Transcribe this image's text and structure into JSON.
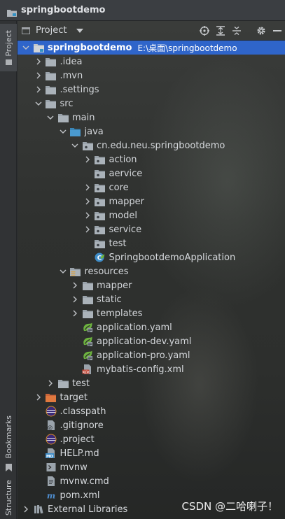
{
  "window": {
    "title": "springbootdemo"
  },
  "stripe": {
    "project": "Project",
    "bookmarks": "Bookmarks",
    "structure": "Structure"
  },
  "toolbar": {
    "view": "Project"
  },
  "tree": [
    {
      "label": "springbootdemo",
      "path": "E:\\桌面\\springbootdemo",
      "indent": 0,
      "arrow": "down",
      "icon": "module",
      "selected": true,
      "bold": true
    },
    {
      "label": ".idea",
      "indent": 1,
      "arrow": "right",
      "icon": "folder"
    },
    {
      "label": ".mvn",
      "indent": 1,
      "arrow": "right",
      "icon": "folder"
    },
    {
      "label": ".settings",
      "indent": 1,
      "arrow": "right",
      "icon": "folder"
    },
    {
      "label": "src",
      "indent": 1,
      "arrow": "down",
      "icon": "folder"
    },
    {
      "label": "main",
      "indent": 2,
      "arrow": "down",
      "icon": "folder"
    },
    {
      "label": "java",
      "indent": 3,
      "arrow": "down",
      "icon": "folder-src"
    },
    {
      "label": "cn.edu.neu.springbootdemo",
      "indent": 4,
      "arrow": "down",
      "icon": "package"
    },
    {
      "label": "action",
      "indent": 5,
      "arrow": "right",
      "icon": "package"
    },
    {
      "label": "aervice",
      "indent": 5,
      "arrow": "none",
      "icon": "package"
    },
    {
      "label": "core",
      "indent": 5,
      "arrow": "right",
      "icon": "package"
    },
    {
      "label": "mapper",
      "indent": 5,
      "arrow": "right",
      "icon": "package"
    },
    {
      "label": "model",
      "indent": 5,
      "arrow": "right",
      "icon": "package"
    },
    {
      "label": "service",
      "indent": 5,
      "arrow": "right",
      "icon": "package"
    },
    {
      "label": "test",
      "indent": 5,
      "arrow": "none",
      "icon": "package"
    },
    {
      "label": "SpringbootdemoApplication",
      "indent": 5,
      "arrow": "none",
      "icon": "spring-class"
    },
    {
      "label": "resources",
      "indent": 3,
      "arrow": "down",
      "icon": "folder-res"
    },
    {
      "label": "mapper",
      "indent": 4,
      "arrow": "right",
      "icon": "folder"
    },
    {
      "label": "static",
      "indent": 4,
      "arrow": "right",
      "icon": "folder"
    },
    {
      "label": "templates",
      "indent": 4,
      "arrow": "right",
      "icon": "folder"
    },
    {
      "label": "application.yaml",
      "indent": 4,
      "arrow": "none",
      "icon": "spring-yaml"
    },
    {
      "label": "application-dev.yaml",
      "indent": 4,
      "arrow": "none",
      "icon": "spring-yaml"
    },
    {
      "label": "application-pro.yaml",
      "indent": 4,
      "arrow": "none",
      "icon": "spring-yaml"
    },
    {
      "label": "mybatis-config.xml",
      "indent": 4,
      "arrow": "none",
      "icon": "xml"
    },
    {
      "label": "test",
      "indent": 2,
      "arrow": "right",
      "icon": "folder"
    },
    {
      "label": "target",
      "indent": 1,
      "arrow": "right",
      "icon": "folder-target"
    },
    {
      "label": ".classpath",
      "indent": 1,
      "arrow": "none",
      "icon": "eclipse"
    },
    {
      "label": ".gitignore",
      "indent": 1,
      "arrow": "none",
      "icon": "gitignore"
    },
    {
      "label": ".project",
      "indent": 1,
      "arrow": "none",
      "icon": "eclipse"
    },
    {
      "label": "HELP.md",
      "indent": 1,
      "arrow": "none",
      "icon": "md"
    },
    {
      "label": "mvnw",
      "indent": 1,
      "arrow": "none",
      "icon": "shell"
    },
    {
      "label": "mvnw.cmd",
      "indent": 1,
      "arrow": "none",
      "icon": "text"
    },
    {
      "label": "pom.xml",
      "indent": 1,
      "arrow": "none",
      "icon": "maven"
    },
    {
      "label": "External Libraries",
      "indent": 0,
      "arrow": "right",
      "icon": "libraries"
    }
  ],
  "watermark": "CSDN @二哈喇子！"
}
